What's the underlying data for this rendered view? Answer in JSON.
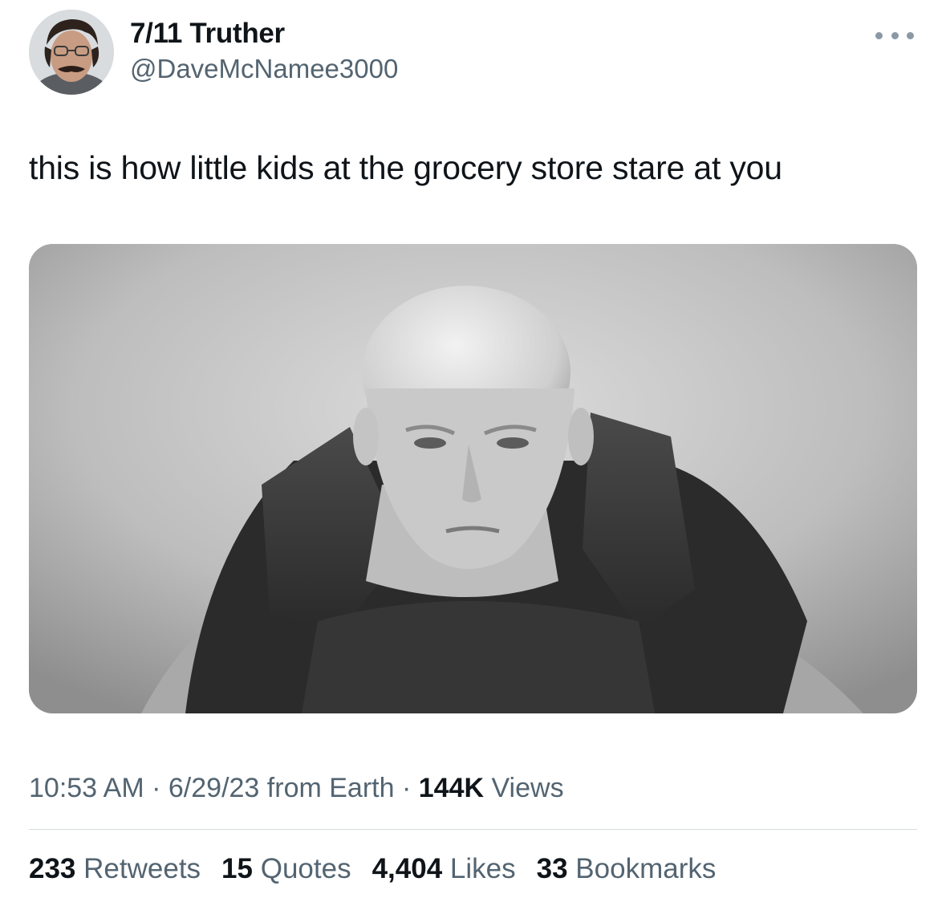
{
  "author": {
    "display_name": "7/11 Truther",
    "handle": "@DaveMcNamee3000"
  },
  "tweet": {
    "text": "this is how little kids at the grocery store stare at you"
  },
  "meta": {
    "time": "10:53 AM",
    "separator": "·",
    "date": "6/29/23",
    "source": "from Earth",
    "views_count": "144K",
    "views_label": "Views"
  },
  "stats": {
    "retweets_count": "233",
    "retweets_label": "Retweets",
    "quotes_count": "15",
    "quotes_label": "Quotes",
    "likes_count": "4,404",
    "likes_label": "Likes",
    "bookmarks_count": "33",
    "bookmarks_label": "Bookmarks"
  },
  "icons": {
    "more": "more-horizontal-icon"
  },
  "colors": {
    "text_primary": "#0f1419",
    "text_secondary": "#536471",
    "divider": "#d7dbdf"
  }
}
